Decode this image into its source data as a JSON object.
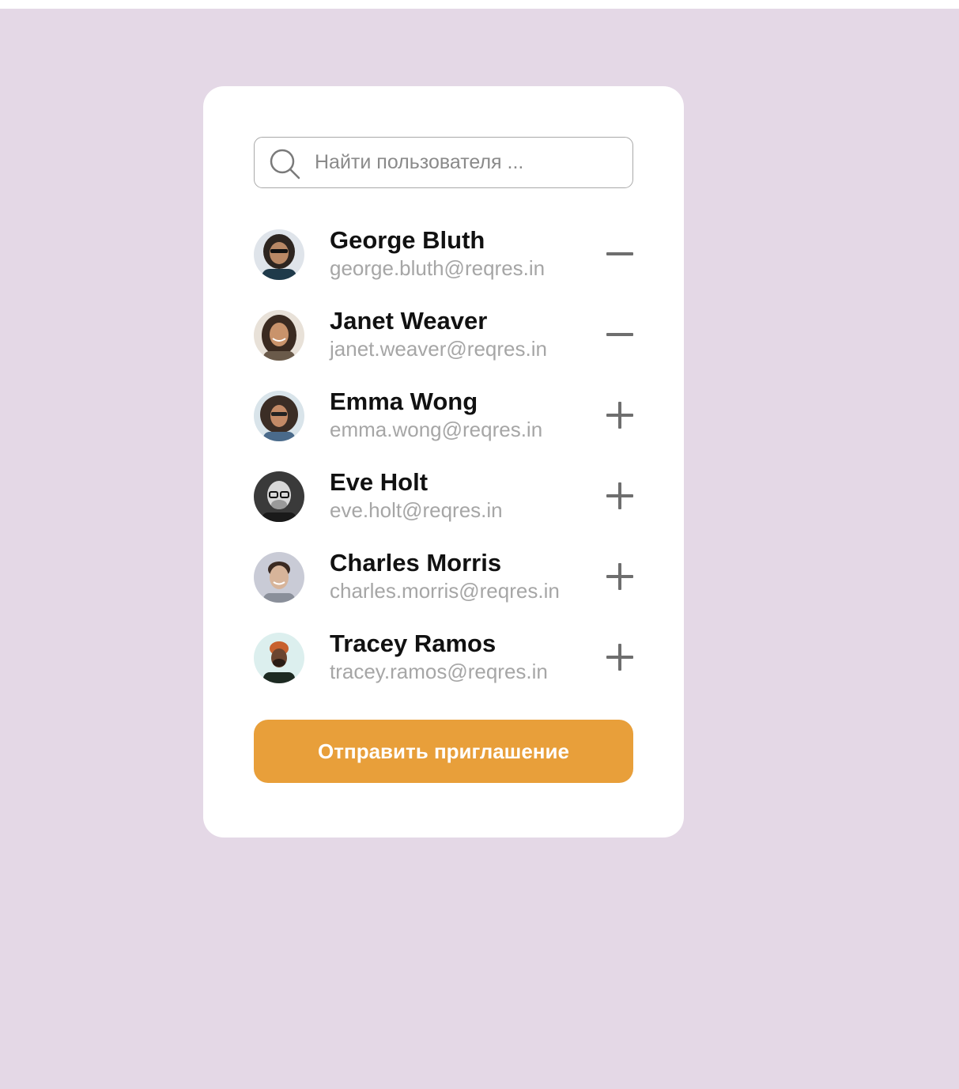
{
  "search": {
    "placeholder": "Найти пользователя ...",
    "icon": "search-icon"
  },
  "users": [
    {
      "name": "George Bluth",
      "email": "george.bluth@reqres.in",
      "action": "remove",
      "action_icon": "minus-icon"
    },
    {
      "name": "Janet Weaver",
      "email": "janet.weaver@reqres.in",
      "action": "remove",
      "action_icon": "minus-icon"
    },
    {
      "name": "Emma Wong",
      "email": "emma.wong@reqres.in",
      "action": "add",
      "action_icon": "plus-icon"
    },
    {
      "name": "Eve Holt",
      "email": "eve.holt@reqres.in",
      "action": "add",
      "action_icon": "plus-icon"
    },
    {
      "name": "Charles Morris",
      "email": "charles.morris@reqres.in",
      "action": "add",
      "action_icon": "plus-icon"
    },
    {
      "name": "Tracey Ramos",
      "email": "tracey.ramos@reqres.in",
      "action": "add",
      "action_icon": "plus-icon"
    }
  ],
  "send_button": {
    "label": "Отправить приглашение"
  },
  "colors": {
    "page_background": "#e4d8e6",
    "card_background": "#ffffff",
    "accent": "#e89f3a",
    "name_text": "#111111",
    "email_text": "#a6a6a6",
    "action_icon": "#6e6e6e"
  }
}
